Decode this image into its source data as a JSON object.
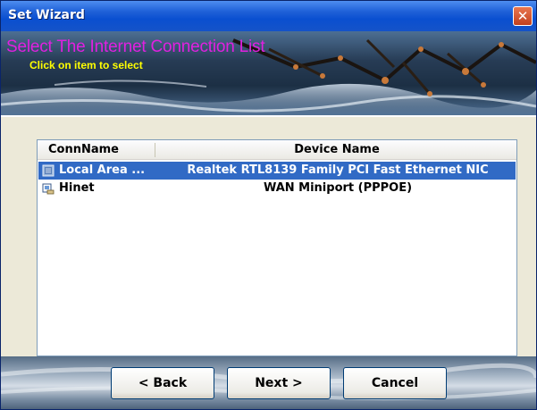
{
  "window": {
    "title": "Set Wizard",
    "close_icon": "close-icon"
  },
  "banner": {
    "title": "Select The Internet Connection List",
    "subtitle": "Click on item to select"
  },
  "list": {
    "columns": [
      "ConnName",
      "Device Name"
    ],
    "rows": [
      {
        "conn": "Local Area ...",
        "device": "Realtek RTL8139 Family PCI Fast Ethernet NIC",
        "icon": "network-adapter-icon",
        "selected": true
      },
      {
        "conn": "Hinet",
        "device": "WAN Miniport (PPPOE)",
        "icon": "dialup-connection-icon",
        "selected": false
      }
    ]
  },
  "buttons": {
    "back": "< Back",
    "next": "Next >",
    "cancel": "Cancel"
  },
  "colors": {
    "titlebar": "#0a4fd0",
    "selection": "#316ac5",
    "banner_title": "#e020e0",
    "banner_subtitle": "#ffff00"
  }
}
